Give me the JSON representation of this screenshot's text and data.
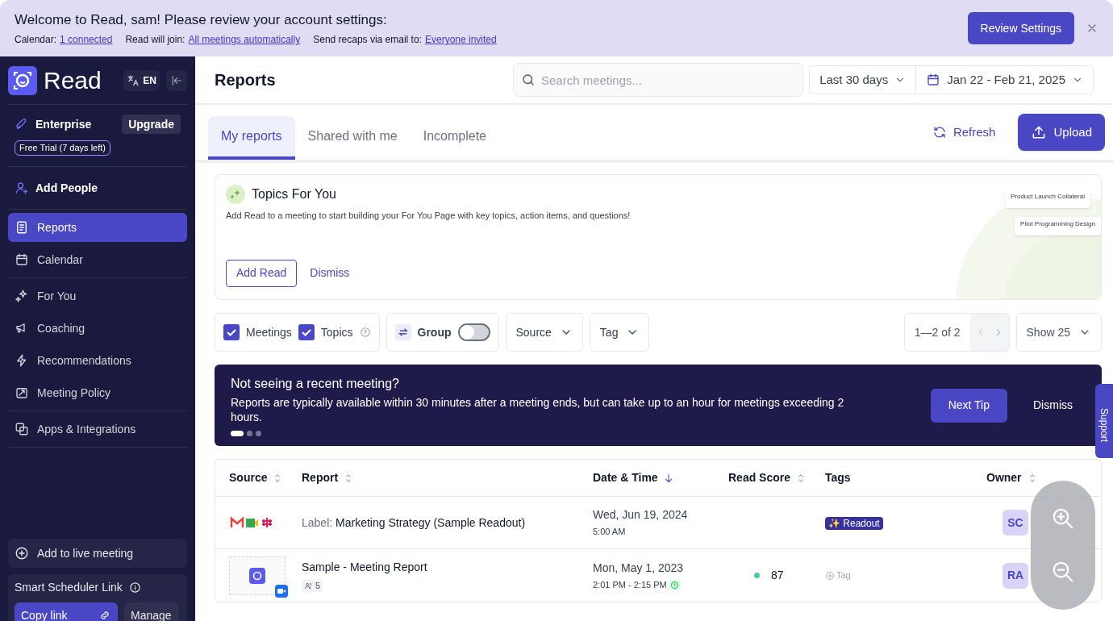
{
  "banner": {
    "title": "Welcome to Read, sam! Please review your account settings:",
    "items": [
      {
        "label": "Calendar:",
        "link": "1 connected"
      },
      {
        "label": "Read will join:",
        "link": "All meetings automatically"
      },
      {
        "label": "Send recaps via email to:",
        "link": "Everyone invited"
      }
    ],
    "button": "Review Settings"
  },
  "sidebar": {
    "brand": "Read",
    "language": "EN",
    "plan": "Enterprise",
    "upgrade": "Upgrade",
    "trial": "Free Trial (7 days left)",
    "add_people": "Add People",
    "groups": [
      [
        {
          "label": "Reports",
          "selected": true
        },
        {
          "label": "Calendar",
          "selected": false
        }
      ],
      [
        {
          "label": "For You",
          "selected": false
        },
        {
          "label": "Coaching",
          "selected": false
        },
        {
          "label": "Recommendations",
          "selected": false
        },
        {
          "label": "Meeting Policy",
          "selected": false
        }
      ],
      [
        {
          "label": "Apps & Integrations",
          "selected": false
        }
      ]
    ],
    "live": "Add to live meeting",
    "scheduler": "Smart Scheduler Link",
    "copy": "Copy link",
    "manage": "Manage"
  },
  "header": {
    "title": "Reports",
    "search_placeholder": "Search meetings...",
    "range": "Last 30 days",
    "dates": "Jan 22 - Feb 21, 2025"
  },
  "tabs": [
    {
      "label": "My reports",
      "selected": true
    },
    {
      "label": "Shared with me",
      "selected": false
    },
    {
      "label": "Incomplete",
      "selected": false
    }
  ],
  "actions": {
    "refresh": "Refresh",
    "upload": "Upload"
  },
  "topics": {
    "title": "Topics For You",
    "text": "Add Read to a meeting to start building your For You Page with key topics, action items, and questions!",
    "add": "Add Read",
    "dismiss": "Dismiss",
    "previews": [
      {
        "title": "Product Launch Collateral"
      },
      {
        "title": "Pilot Programming Design"
      }
    ]
  },
  "filters": {
    "meetings": {
      "label": "Meetings",
      "checked": true
    },
    "topics": {
      "label": "Topics",
      "checked": true
    },
    "group": {
      "label": "Group",
      "on": false
    },
    "source": "Source",
    "tag": "Tag",
    "pager": "1—2 of 2",
    "show": "Show 25"
  },
  "tip": {
    "title": "Not seeing a recent meeting?",
    "body": "Reports are typically available within 30 minutes after a meeting ends, but can take up to an hour for meetings exceeding 2 hours.",
    "next": "Next Tip",
    "dismiss": "Dismiss",
    "dots": [
      {
        "selected": true
      },
      {
        "selected": false
      },
      {
        "selected": false
      }
    ]
  },
  "table": {
    "columns": [
      {
        "label": "Source",
        "sorted": false
      },
      {
        "label": "Report",
        "sorted": false
      },
      {
        "label": "Date & Time",
        "sorted": true
      },
      {
        "label": "Read Score",
        "sorted": false
      },
      {
        "label": "Tags",
        "sorted": false
      },
      {
        "label": "Owner",
        "sorted": false
      }
    ],
    "rows": [
      {
        "prefix": "Label:",
        "report": "Marketing Strategy (Sample Readout)",
        "date": "Wed, Jun 19, 2024",
        "time": "5:00 AM",
        "tag": {
          "kind": "badge",
          "text": "✨ Readout"
        },
        "owner": "SC"
      },
      {
        "report": "Sample - Meeting Report",
        "attendees": "5",
        "date": "Mon, May 1, 2023",
        "time": "2:01 PM - 2:15 PM",
        "score": "87",
        "tag": {
          "kind": "add",
          "text": "Tag"
        },
        "owner": "RA"
      }
    ]
  },
  "support": "Support"
}
